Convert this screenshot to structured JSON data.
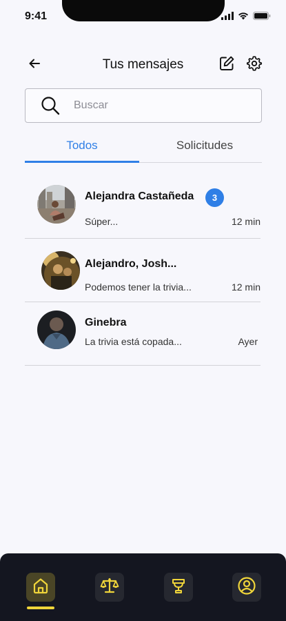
{
  "status_bar": {
    "time": "9:41"
  },
  "header": {
    "title": "Tus mensajes"
  },
  "search": {
    "placeholder": "Buscar",
    "value": ""
  },
  "tabs": [
    {
      "label": "Todos",
      "active": true
    },
    {
      "label": "Solicitudes",
      "active": false
    }
  ],
  "conversations": [
    {
      "name": "Alejandra Castañeda",
      "preview": "Súper...",
      "time": "12 min",
      "unread": "3"
    },
    {
      "name": "Alejandro, Josh...",
      "preview": "Podemos tener la trivia...",
      "time": "12 min"
    },
    {
      "name": "Ginebra",
      "preview": "La trivia está copada...",
      "time": "Ayer"
    }
  ],
  "bottom_nav": {
    "items": [
      {
        "icon": "home-icon",
        "active": true
      },
      {
        "icon": "scales-icon",
        "active": false
      },
      {
        "icon": "trophy-icon",
        "active": false
      },
      {
        "icon": "user-circle-icon",
        "active": false
      }
    ]
  },
  "colors": {
    "accent": "#2f7fe6",
    "nav_background": "#141620",
    "nav_active": "#f0d53a",
    "background": "#f7f7fc"
  }
}
